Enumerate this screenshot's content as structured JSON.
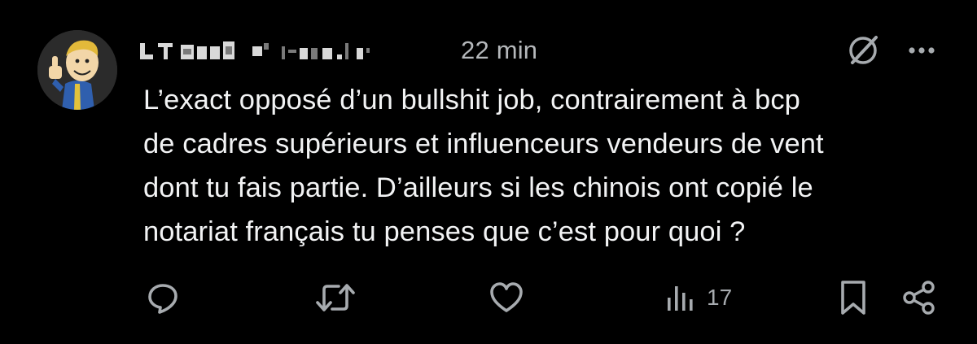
{
  "post": {
    "author": {
      "display_name": "",
      "avatar_icon": "vault-boy-thumbs-up-avatar"
    },
    "timestamp": "22 min",
    "header_icons": [
      "grok-icon",
      "more-icon"
    ],
    "text": "L’exact opposé d’un bullshit job, contrairement à bcp\nde cadres supérieurs et influenceurs vendeurs de vent\ndont tu fais partie. D’ailleurs si les chinois ont copié le\nnotariat français tu penses que c’est pour quoi ?",
    "actions": {
      "reply_icon": "reply-icon",
      "repost_icon": "repost-icon",
      "like_icon": "like-icon",
      "views_icon": "views-icon",
      "views_count": "17",
      "bookmark_icon": "bookmark-icon",
      "share_icon": "share-icon"
    },
    "colors": {
      "background": "#000000",
      "text": "#e7e9ea",
      "muted": "#a7abaf"
    }
  }
}
